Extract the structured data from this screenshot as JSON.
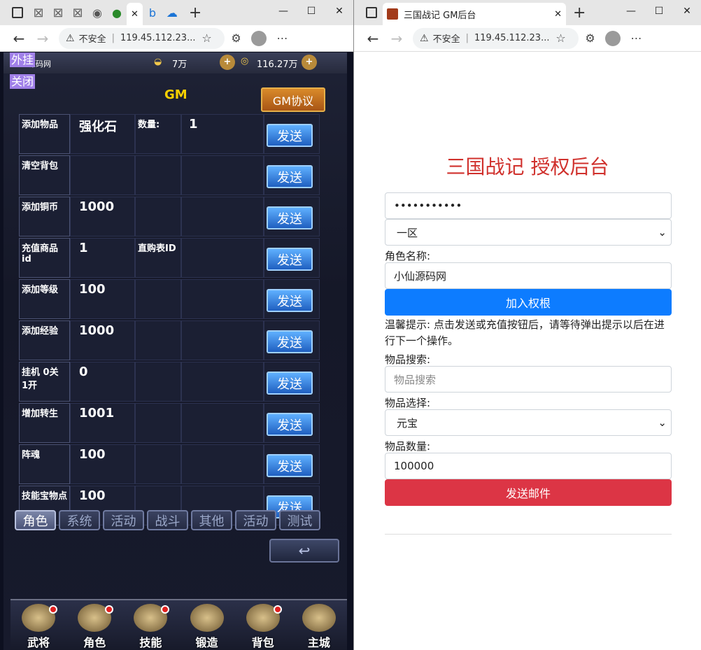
{
  "left_window": {
    "url": "119.45.112.23...",
    "insecure": "不安全",
    "game": {
      "site_fragment": "源码网",
      "gold": "7万",
      "coins": "116.27万",
      "ext_top": "外挂",
      "ext_close": "关闭",
      "gm_title": "GM",
      "gm_protocol": "GM协议",
      "send_label": "发送",
      "rows": [
        {
          "name": "添加物品",
          "value": "强化石",
          "extra_label": "数量:",
          "extra_value": "1"
        },
        {
          "name": "清空背包",
          "value": "",
          "extra_label": "",
          "extra_value": ""
        },
        {
          "name": "添加铜币",
          "value": "1000",
          "extra_label": "",
          "extra_value": ""
        },
        {
          "name": "充值商品id",
          "value": "1",
          "extra_label": "直购表ID",
          "extra_value": ""
        },
        {
          "name": "添加等级",
          "value": "100",
          "extra_label": "",
          "extra_value": ""
        },
        {
          "name": "添加经验",
          "value": "1000",
          "extra_label": "",
          "extra_value": ""
        },
        {
          "name": "挂机 0关 1开",
          "value": "0",
          "extra_label": "",
          "extra_value": ""
        },
        {
          "name": "增加转生",
          "value": "1001",
          "extra_label": "",
          "extra_value": ""
        },
        {
          "name": "阵魂",
          "value": "100",
          "extra_label": "",
          "extra_value": ""
        },
        {
          "name": "技能宝物点",
          "value": "100",
          "extra_label": "",
          "extra_value": ""
        }
      ],
      "tabs": [
        "角色",
        "系统",
        "活动",
        "战斗",
        "其他",
        "活动",
        "测试"
      ],
      "back_symbol": "↩",
      "bottom_nav": [
        {
          "label": "武将",
          "dot": true
        },
        {
          "label": "角色",
          "dot": true
        },
        {
          "label": "技能",
          "dot": true
        },
        {
          "label": "锻造",
          "dot": false
        },
        {
          "label": "背包",
          "dot": true
        },
        {
          "label": "主城",
          "dot": false
        }
      ]
    }
  },
  "right_window": {
    "tab_title": "三国战记 GM后台",
    "url": "119.45.112.23...",
    "insecure": "不安全",
    "page": {
      "title": "三国战记 授权后台",
      "password": "•••••••••••",
      "server": "一区",
      "role_label": "角色名称:",
      "role_value": "小仙源码网",
      "auth_button": "加入权根",
      "hint": "温馨提示: 点击发送或充值按钮后，请等待弹出提示以后在进行下一个操作。",
      "search_label": "物品搜索:",
      "search_placeholder": "物品搜索",
      "select_label": "物品选择:",
      "item": "元宝",
      "qty_label": "物品数量:",
      "qty": "100000",
      "mail_button": "发送邮件"
    }
  },
  "colors": {
    "title_red": "#d0312d",
    "primary_blue": "#0d7cff",
    "danger_red": "#dc3545"
  }
}
